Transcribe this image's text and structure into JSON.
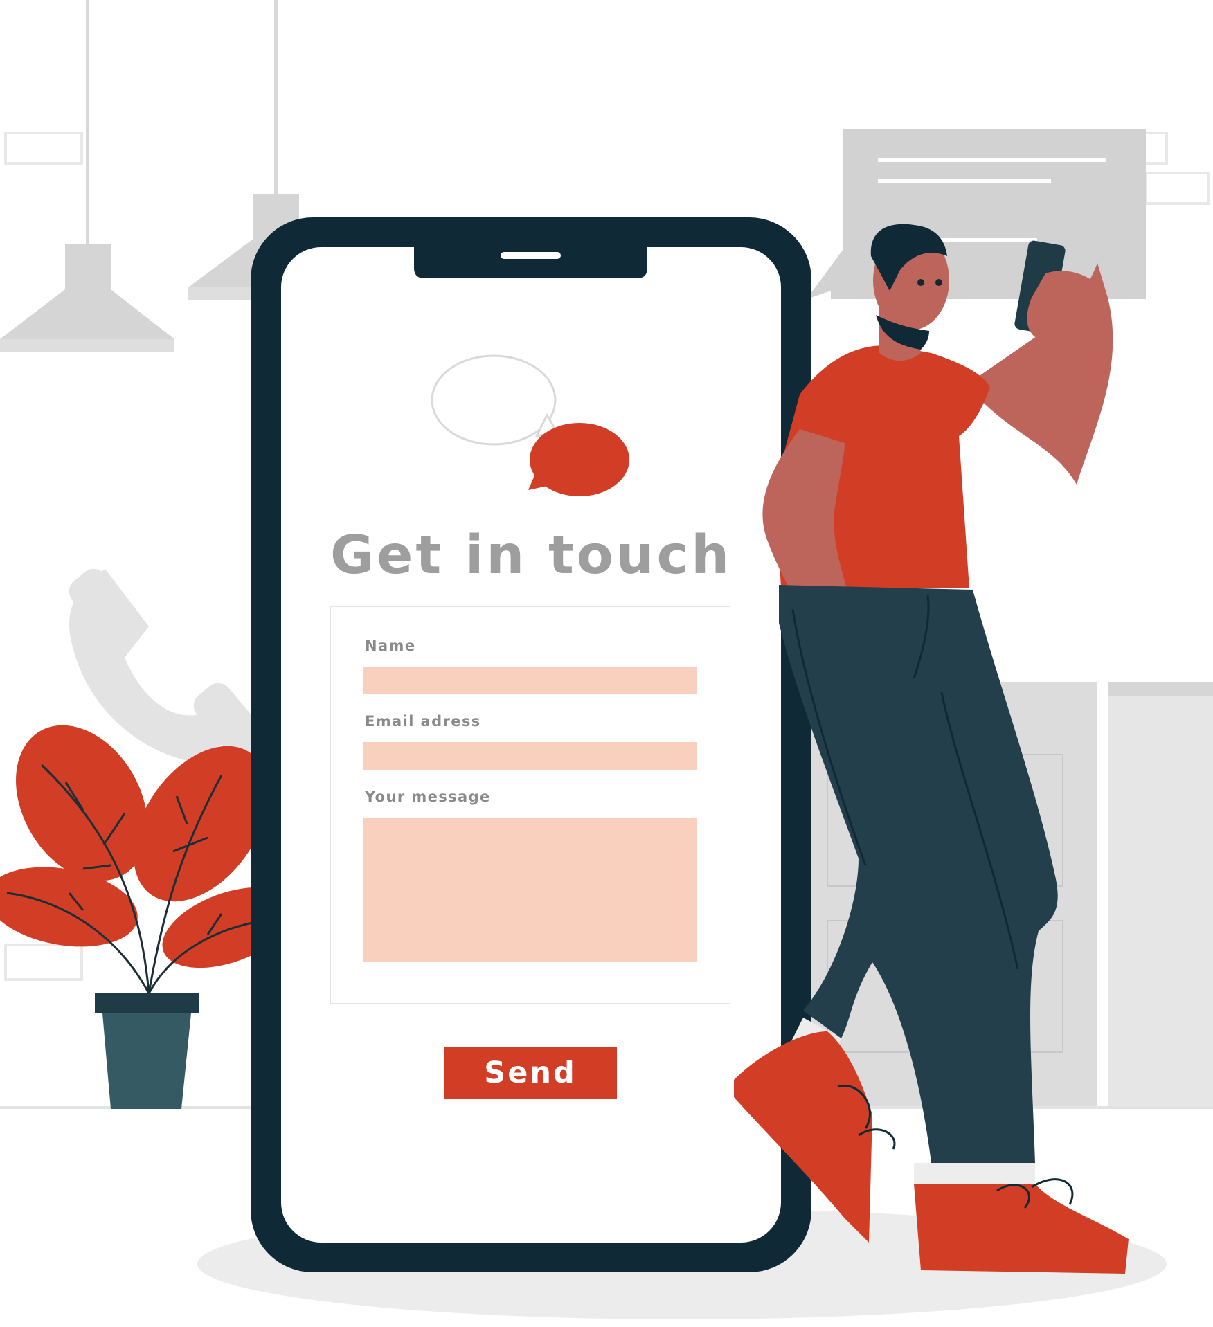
{
  "screen": {
    "title": "Get in touch",
    "form": {
      "name_label": "Name",
      "name_value": "",
      "email_label": "Email adress",
      "email_value": "",
      "message_label": "Your message",
      "message_value": ""
    },
    "send_label": "Send"
  },
  "colors": {
    "accent_red": "#d23d26",
    "field_fill": "#f9cfbd",
    "phone_frame": "#0f2a36",
    "pants": "#243f4c",
    "skin": "#bd655a",
    "scene_gray": "#d4d4d4",
    "title_gray": "#9e9e9e"
  },
  "icons": [
    "ceiling-lamp-icon",
    "wall-phone-icon",
    "speech-bubble-icon",
    "potted-plant-icon",
    "smartphone-icon"
  ]
}
